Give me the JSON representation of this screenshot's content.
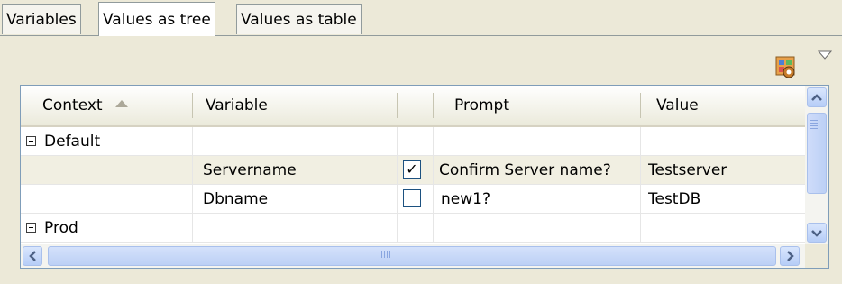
{
  "tabs": [
    {
      "label": "Variables",
      "active": false
    },
    {
      "label": "Values as tree",
      "active": true
    },
    {
      "label": "Values as table",
      "active": false
    }
  ],
  "toolbar": {
    "icons": [
      "properties-icon",
      "view-menu-icon"
    ]
  },
  "table": {
    "columns": [
      "Context",
      "Variable",
      "",
      "Prompt",
      "Value"
    ],
    "sort_column": "Context",
    "sort_direction": "ascending",
    "rows": [
      {
        "context": "Default",
        "expanded": true,
        "variable": "",
        "checked": null,
        "prompt": "",
        "value": ""
      },
      {
        "context": "",
        "expanded": null,
        "variable": "Servername",
        "checked": true,
        "prompt": "Confirm Server name?",
        "value": "Testserver",
        "selected": true
      },
      {
        "context": "",
        "expanded": null,
        "variable": "Dbname",
        "checked": false,
        "prompt": "new1?",
        "value": "TestDB"
      },
      {
        "context": "Prod",
        "expanded": true,
        "variable": "",
        "checked": null,
        "prompt": "",
        "value": ""
      }
    ]
  },
  "colors": {
    "window_bg": "#ece9d8",
    "border": "#7f9db9",
    "scroll_thumb": "#bcd0f5",
    "selected_row": "#f1efe2"
  }
}
